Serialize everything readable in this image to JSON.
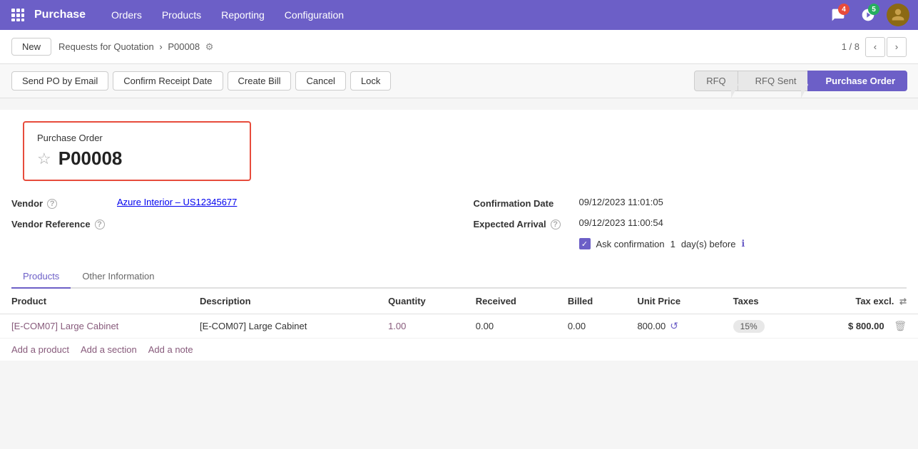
{
  "topnav": {
    "brand": "Purchase",
    "menu_items": [
      "Orders",
      "Products",
      "Reporting",
      "Configuration"
    ],
    "badge_messages": "4",
    "badge_activity": "5"
  },
  "breadcrumb": {
    "new_label": "New",
    "path_parent": "Requests for Quotation",
    "path_current": "P00008"
  },
  "pagination": {
    "current": "1",
    "total": "8",
    "display": "1 / 8"
  },
  "action_buttons": {
    "send_po": "Send PO by Email",
    "confirm_receipt": "Confirm Receipt Date",
    "create_bill": "Create Bill",
    "cancel": "Cancel",
    "lock": "Lock"
  },
  "status_steps": [
    {
      "label": "RFQ",
      "active": false
    },
    {
      "label": "RFQ Sent",
      "active": false
    },
    {
      "label": "Purchase Order",
      "active": true
    }
  ],
  "form": {
    "title_label": "Purchase Order",
    "po_number": "P00008",
    "vendor_label": "Vendor",
    "vendor_value": "Azure Interior – US12345677",
    "vendor_ref_label": "Vendor Reference",
    "vendor_ref_value": "",
    "confirmation_date_label": "Confirmation Date",
    "confirmation_date_value": "09/12/2023 11:01:05",
    "expected_arrival_label": "Expected Arrival",
    "expected_arrival_value": "09/12/2023 11:00:54",
    "ask_confirmation_label": "Ask confirmation",
    "ask_confirmation_value": "1",
    "days_before_label": "day(s) before"
  },
  "tabs": [
    {
      "label": "Products",
      "active": true
    },
    {
      "label": "Other Information",
      "active": false
    }
  ],
  "table": {
    "columns": [
      "Product",
      "Description",
      "Quantity",
      "Received",
      "Billed",
      "Unit Price",
      "Taxes",
      "Tax excl."
    ],
    "rows": [
      {
        "product": "[E-COM07] Large Cabinet",
        "description": "[E-COM07] Large Cabinet",
        "quantity": "1.00",
        "received": "0.00",
        "billed": "0.00",
        "unit_price": "800.00",
        "taxes": "15%",
        "tax_excl": "$ 800.00"
      }
    ]
  },
  "add_links": {
    "add_product": "Add a product",
    "add_section": "Add a section",
    "add_note": "Add a note"
  }
}
